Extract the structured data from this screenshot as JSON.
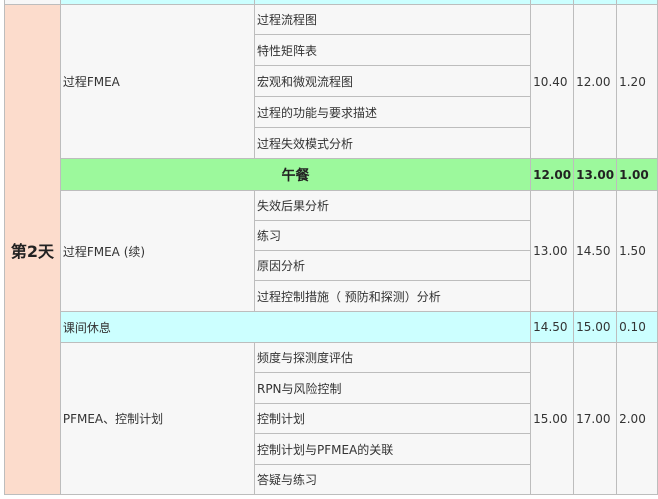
{
  "day": "第2天",
  "sections": [
    {
      "topic": "过程FMEA",
      "items": [
        "过程流程图",
        "特性矩阵表",
        "宏观和微观流程图",
        "过程的功能与要求描述",
        "过程失效模式分析"
      ],
      "start": "10.40",
      "end": "12.00",
      "hours": "1.20"
    },
    {
      "topic": "过程FMEA (续)",
      "items": [
        "失效后果分析",
        "练习",
        "原因分析",
        "过程控制措施（ 预防和探测）分析"
      ],
      "start": "13.00",
      "end": "14.50",
      "hours": "1.50"
    },
    {
      "topic": "PFMEA、控制计划",
      "items": [
        "频度与探测度评估",
        "RPN与风险控制",
        "控制计划",
        "控制计划与PFMEA的关联",
        "答疑与练习"
      ],
      "start": "15.00",
      "end": "17.00",
      "hours": "2.00"
    }
  ],
  "lunch": {
    "label": "午餐",
    "start": "12.00",
    "end": "13.00",
    "hours": "1.00"
  },
  "break": {
    "label": "课间休息",
    "start": "14.50",
    "end": "15.00",
    "hours": "0.10"
  },
  "colors": {
    "day_bg": "#fcdccc",
    "lunch_bg": "#9cf99c",
    "break_bg": "#ccffff",
    "cell_bg": "#f7f7f7",
    "border": "#bdbdbd"
  }
}
